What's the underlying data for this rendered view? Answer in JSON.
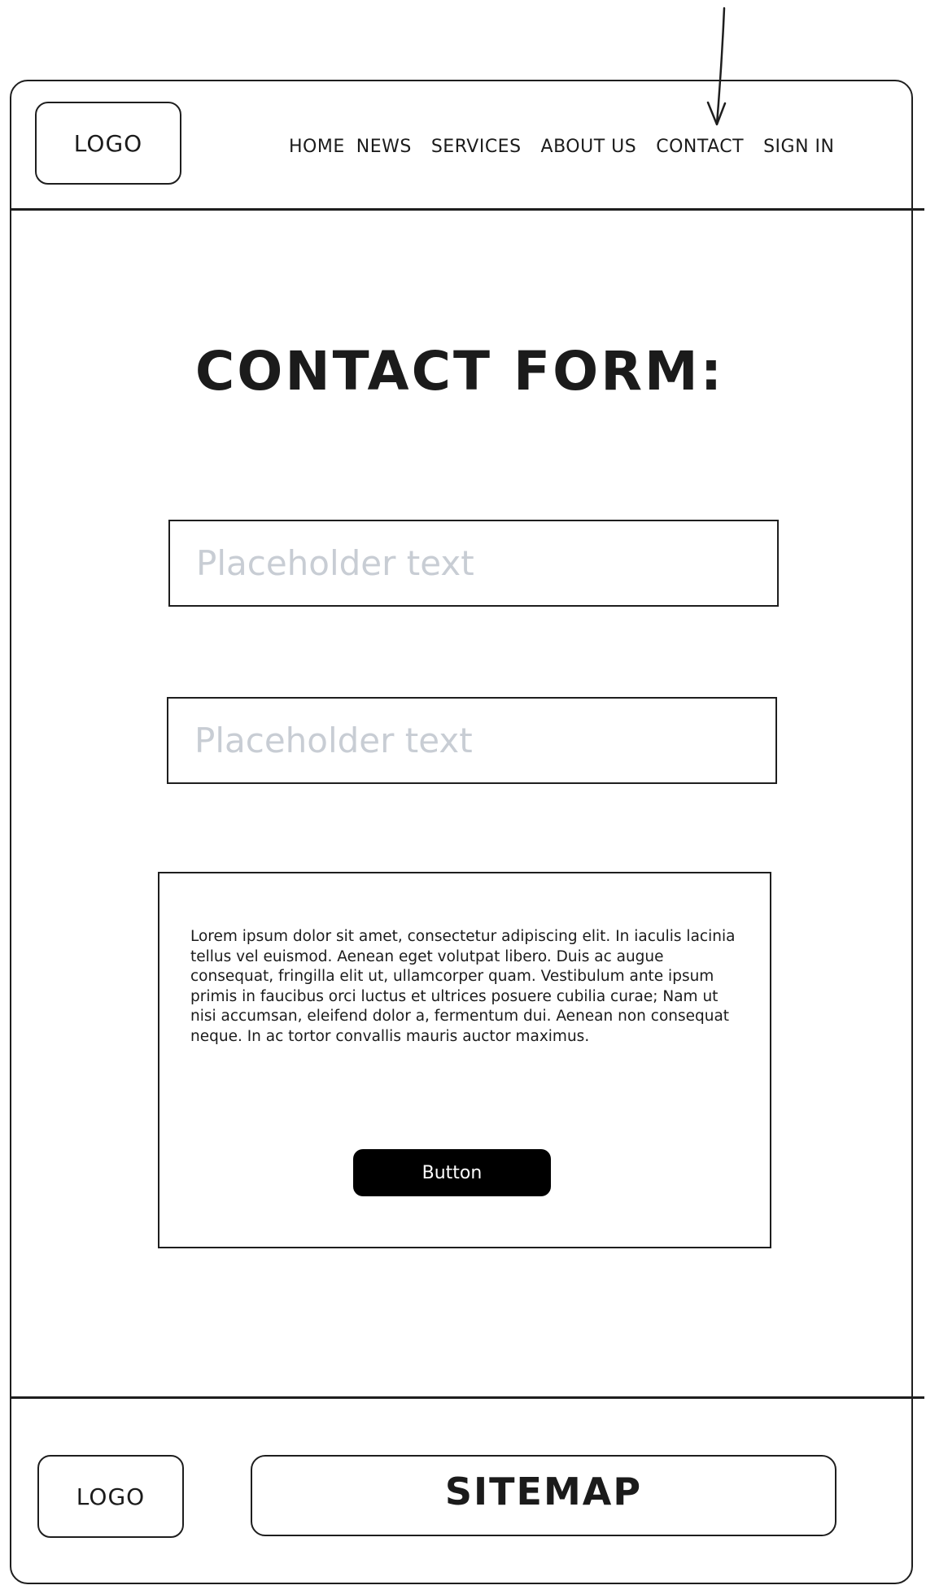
{
  "header": {
    "logo": "LOGO",
    "nav": [
      "HOME",
      "NEWS",
      "SERVICES",
      "ABOUT US",
      "CONTACT",
      "SIGN IN"
    ],
    "current_page": "CONTACT"
  },
  "main": {
    "title": "CONTACT FORM:",
    "field_1": {
      "placeholder": "Placeholder text",
      "value": ""
    },
    "field_2": {
      "placeholder": "Placeholder text",
      "value": ""
    },
    "message_text": "Lorem ipsum dolor sit amet, consectetur adipiscing elit. In iaculis lacinia tellus vel euismod. Aenean eget volutpat libero. Duis ac augue consequat, fringilla elit ut, ullamcorper quam. Vestibulum ante ipsum primis in faucibus orci luctus et ultrices posuere cubilia curae; Nam ut nisi accumsan, eleifend dolor a, fermentum dui. Aenean non consequat neque. In ac tortor convallis mauris auctor maximus.",
    "button_label": "Button"
  },
  "footer": {
    "logo": "LOGO",
    "sitemap": "SITEMAP"
  },
  "colors": {
    "ink": "#1e1e1e",
    "placeholder": "#c8cdd4",
    "button_bg": "#000000",
    "button_text": "#ffffff"
  },
  "icons": {
    "pointer": "arrow-down-icon"
  }
}
